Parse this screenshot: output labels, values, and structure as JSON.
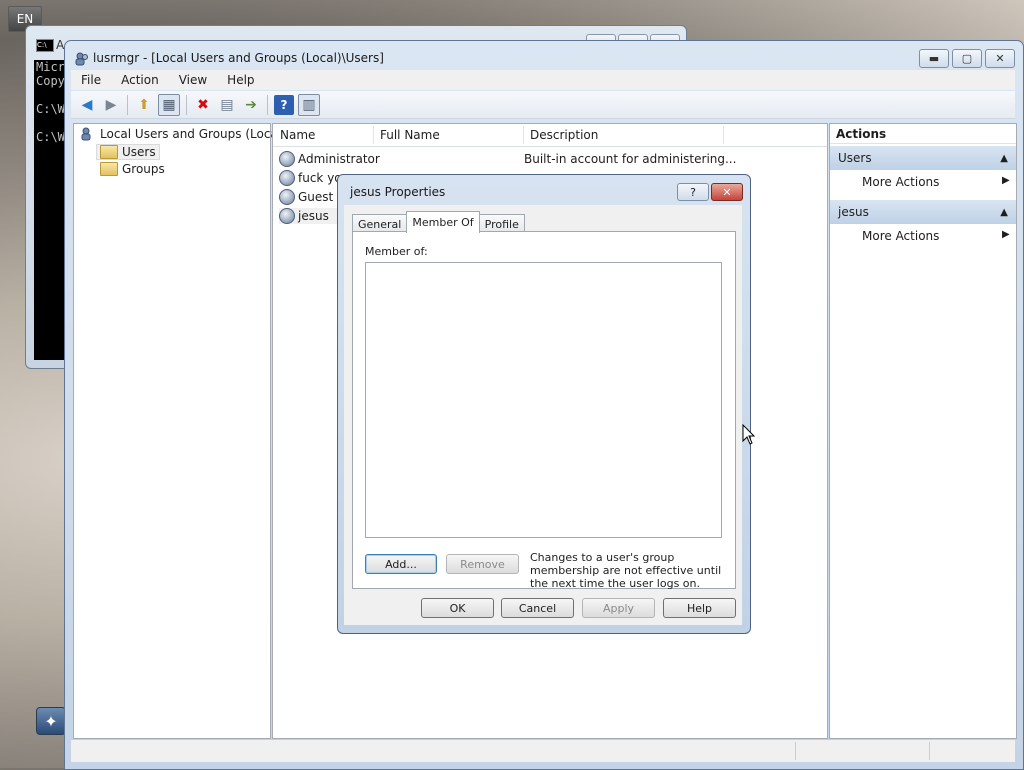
{
  "language_badge": "EN",
  "console": {
    "title": "A",
    "lines": [
      "Micr",
      "Copy",
      "",
      "C:\\W",
      "",
      "C:\\W"
    ]
  },
  "window": {
    "title": "lusrmgr - [Local Users and Groups (Local)\\Users]",
    "menu": [
      "File",
      "Action",
      "View",
      "Help"
    ]
  },
  "tree": {
    "root": "Local Users and Groups (Local)",
    "items": [
      "Users",
      "Groups"
    ]
  },
  "list": {
    "columns": [
      "Name",
      "Full Name",
      "Description"
    ],
    "rows": [
      {
        "name": "Administrator",
        "full_name": "",
        "description": "Built-in account for administering..."
      },
      {
        "name": "fuck you",
        "full_name": "",
        "description": ""
      },
      {
        "name": "Guest",
        "full_name": "",
        "description": ""
      },
      {
        "name": "jesus",
        "full_name": "",
        "description": ""
      }
    ]
  },
  "actions": {
    "header": "Actions",
    "sections": [
      {
        "title": "Users",
        "item": "More Actions"
      },
      {
        "title": "jesus",
        "item": "More Actions"
      }
    ]
  },
  "dialog": {
    "title": "jesus Properties",
    "tabs": [
      "General",
      "Member Of",
      "Profile"
    ],
    "active_tab": "Member Of",
    "member_of_label": "Member of:",
    "add_label": "Add...",
    "remove_label": "Remove",
    "note": "Changes to a user's group membership are not effective until the next time the user logs on.",
    "ok_label": "OK",
    "cancel_label": "Cancel",
    "apply_label": "Apply",
    "help_label": "Help"
  },
  "colors": {
    "accent": "#c1d2e6",
    "close_red": "#c5443a"
  }
}
